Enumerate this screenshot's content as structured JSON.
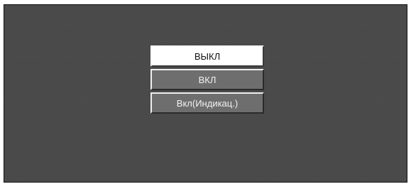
{
  "menu": {
    "options": [
      {
        "label": "ВЫКЛ",
        "selected": true
      },
      {
        "label": "ВКЛ",
        "selected": false
      },
      {
        "label": "Вкл(Индикац.)",
        "selected": false
      }
    ]
  },
  "colors": {
    "screen_background": "#4b4b4b",
    "selected_background": "#ffffff",
    "option_background": "#6e6e6e"
  }
}
